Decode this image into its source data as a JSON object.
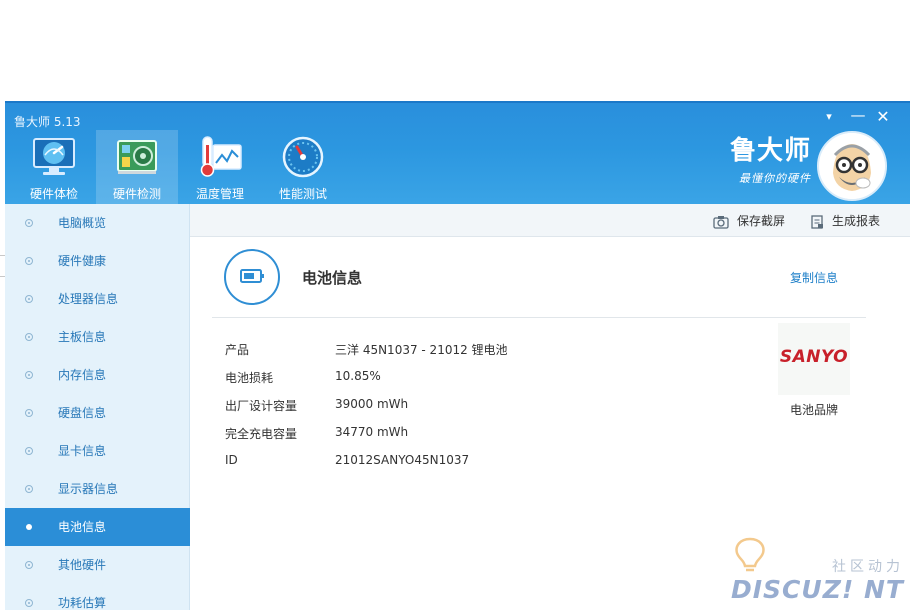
{
  "window": {
    "title": "鲁大师 5.13"
  },
  "window_controls": {
    "menu": "▾",
    "minimize": "—",
    "close": "✕"
  },
  "toolbar": {
    "items": [
      {
        "label": "硬件体检",
        "icon": "monitor-check-icon",
        "active": false
      },
      {
        "label": "硬件检测",
        "icon": "circuit-board-icon",
        "active": true
      },
      {
        "label": "温度管理",
        "icon": "thermometer-chart-icon",
        "active": false
      },
      {
        "label": "性能测试",
        "icon": "speedometer-icon",
        "active": false
      }
    ]
  },
  "brand": {
    "name": "鲁大师",
    "slogan": "最懂你的硬件",
    "avatar_icon": "ludashi-mascot-icon"
  },
  "sidebar": {
    "items": [
      {
        "label": "电脑概览",
        "active": false
      },
      {
        "label": "硬件健康",
        "active": false
      },
      {
        "label": "处理器信息",
        "active": false
      },
      {
        "label": "主板信息",
        "active": false
      },
      {
        "label": "内存信息",
        "active": false
      },
      {
        "label": "硬盘信息",
        "active": false
      },
      {
        "label": "显卡信息",
        "active": false
      },
      {
        "label": "显示器信息",
        "active": false
      },
      {
        "label": "电池信息",
        "active": true
      },
      {
        "label": "其他硬件",
        "active": false
      },
      {
        "label": "功耗估算",
        "active": false
      }
    ]
  },
  "actions": {
    "screenshot": "保存截屏",
    "report": "生成报表"
  },
  "section": {
    "title": "电池信息",
    "icon": "battery-icon",
    "copy_label": "复制信息",
    "rows": [
      {
        "key": "产品",
        "value": "三洋 45N1037 - 21012 锂电池"
      },
      {
        "key": "电池损耗",
        "value": "10.85%"
      },
      {
        "key": "出厂设计容量",
        "value": "39000 mWh"
      },
      {
        "key": "完全充电容量",
        "value": "34770 mWh"
      },
      {
        "key": "ID",
        "value": "21012SANYO45N1037"
      }
    ],
    "brand_logo": "SANYO",
    "brand_caption": "电池品牌"
  },
  "watermark": {
    "cn": "社区动力",
    "en": "DISCUZ! NT"
  },
  "colors": {
    "accent": "#2b8ed7",
    "title_bar": "#2c97e0",
    "sidebar_bg": "#e4f2fb",
    "link": "#1e7fc8",
    "logo_red": "#c8202a"
  }
}
